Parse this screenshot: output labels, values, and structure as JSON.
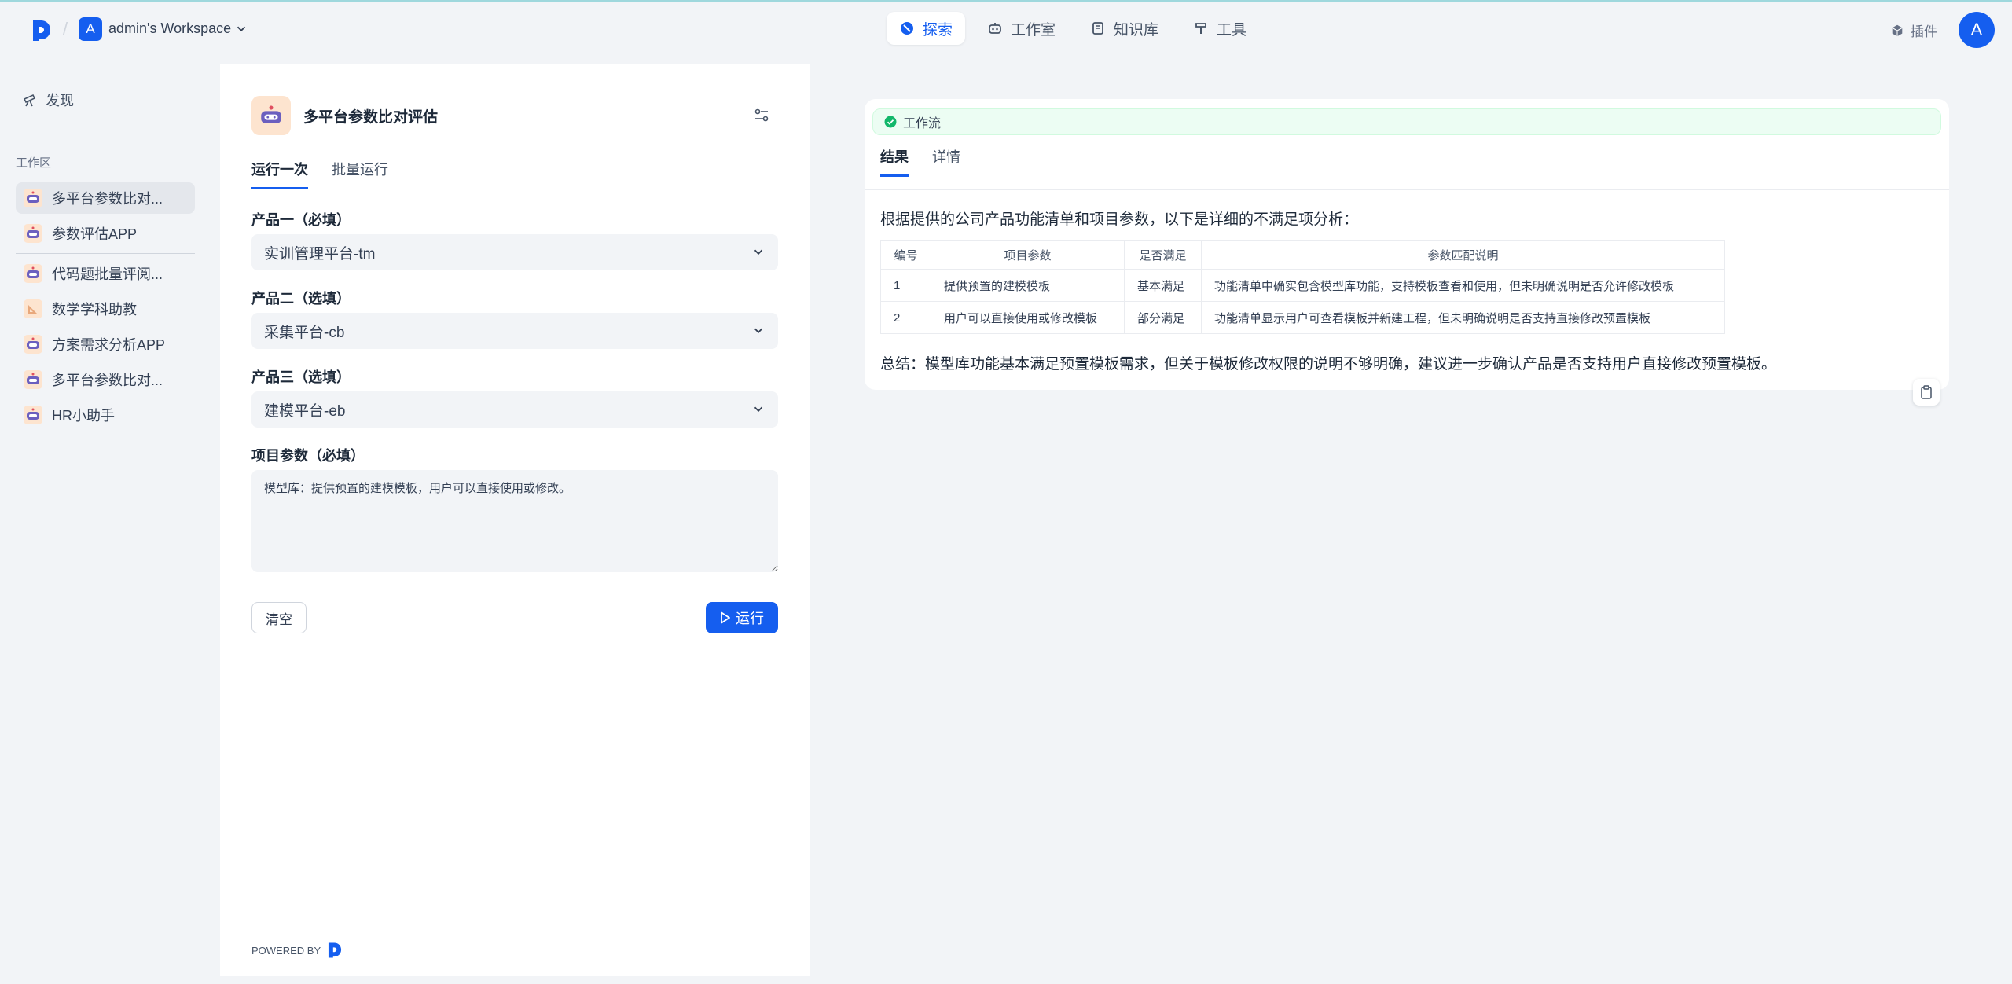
{
  "header": {
    "workspace_initial": "A",
    "workspace_name": "admin's Workspace",
    "nav": [
      {
        "label": "探索",
        "icon": "compass-icon",
        "active": true
      },
      {
        "label": "工作室",
        "icon": "robot-icon",
        "active": false
      },
      {
        "label": "知识库",
        "icon": "book-icon",
        "active": false
      },
      {
        "label": "工具",
        "icon": "hammer-icon",
        "active": false
      }
    ],
    "plugin_label": "插件",
    "user_initial": "A"
  },
  "sidebar": {
    "discover_label": "发现",
    "workspace_label": "工作区",
    "apps": [
      {
        "label": "多平台参数比对...",
        "icon": "robot-icon",
        "active": true
      },
      {
        "label": "参数评估APP",
        "icon": "robot-icon",
        "active": false
      },
      {
        "label": "代码题批量评阅...",
        "icon": "robot-icon",
        "active": false
      },
      {
        "label": "数学学科助教",
        "icon": "ruler-icon",
        "active": false
      },
      {
        "label": "方案需求分析APP",
        "icon": "robot-icon",
        "active": false
      },
      {
        "label": "多平台参数比对...",
        "icon": "robot-icon",
        "active": false
      },
      {
        "label": "HR小助手",
        "icon": "robot-icon",
        "active": false
      }
    ]
  },
  "form": {
    "app_title": "多平台参数比对评估",
    "tabs": [
      "运行一次",
      "批量运行"
    ],
    "product1_label": "产品一（必填）",
    "product1_value": "实训管理平台-tm",
    "product2_label": "产品二（选填）",
    "product2_value": "采集平台-cb",
    "product3_label": "产品三（选填）",
    "product3_value": "建模平台-eb",
    "params_label": "项目参数（必填）",
    "params_value": "模型库：提供预置的建模模板，用户可以直接使用或修改。",
    "clear_label": "清空",
    "run_label": "运行",
    "powered_by": "POWERED BY"
  },
  "result": {
    "workflow_label": "工作流",
    "tabs": [
      "结果",
      "详情"
    ],
    "intro": "根据提供的公司产品功能清单和项目参数，以下是详细的不满足项分析：",
    "table": {
      "headers": [
        "编号",
        "项目参数",
        "是否满足",
        "参数匹配说明"
      ],
      "rows": [
        [
          "1",
          "提供预置的建模模板",
          "基本满足",
          "功能清单中确实包含模型库功能，支持模板查看和使用，但未明确说明是否允许修改模板"
        ],
        [
          "2",
          "用户可以直接使用或修改模板",
          "部分满足",
          "功能清单显示用户可查看模板并新建工程，但未明确说明是否支持直接修改预置模板"
        ]
      ]
    },
    "summary": "总结：模型库功能基本满足预置模板需求，但关于模板修改权限的说明不够明确，建议进一步确认产品是否支持用户直接修改预置模板。"
  },
  "colors": {
    "accent": "#155eef",
    "success": "#12b76a",
    "page_bg": "#f2f4f7"
  }
}
